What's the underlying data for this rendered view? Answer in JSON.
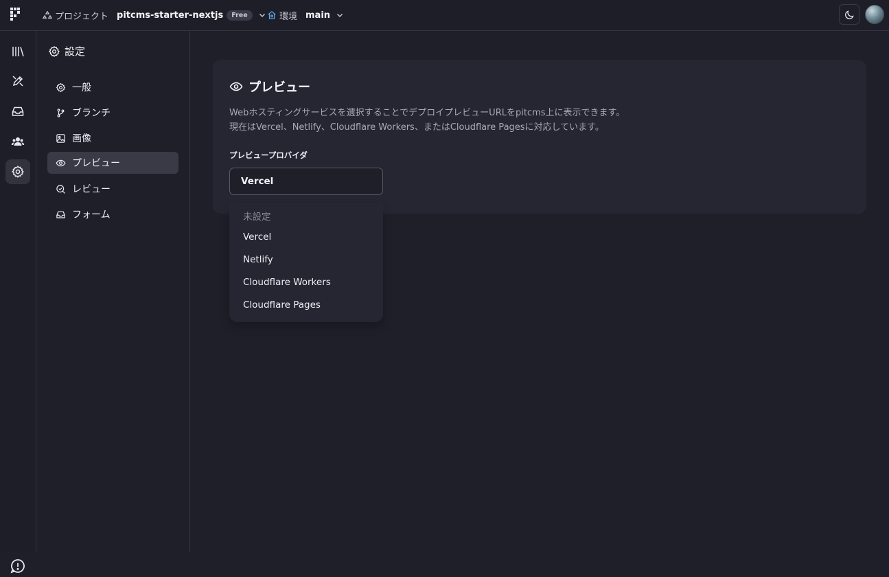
{
  "topbar": {
    "project_label": "プロジェクト",
    "project_name": "pitcms-starter-nextjs",
    "plan_badge": "Free",
    "env_label": "環境",
    "env_name": "main",
    "icons": [
      "logo-icon",
      "project-icon",
      "chevron-down-icon",
      "environment-icon",
      "moon-icon",
      "avatar"
    ]
  },
  "rail": {
    "items": [
      {
        "name": "library-icon"
      },
      {
        "name": "design-icon"
      },
      {
        "name": "inbox-icon"
      },
      {
        "name": "users-icon"
      },
      {
        "name": "settings-icon",
        "active": true
      },
      {
        "name": "help-icon"
      }
    ]
  },
  "sidebar": {
    "title": "設定",
    "items": [
      {
        "label": "一般",
        "icon": "gear-icon"
      },
      {
        "label": "ブランチ",
        "icon": "branch-icon"
      },
      {
        "label": "画像",
        "icon": "image-icon"
      },
      {
        "label": "プレビュー",
        "icon": "eye-icon",
        "active": true
      },
      {
        "label": "レビュー",
        "icon": "review-icon"
      },
      {
        "label": "フォーム",
        "icon": "inbox-icon"
      }
    ]
  },
  "main": {
    "title": "プレビュー",
    "description_line1": "Webホスティングサービスを選択することでデプロイプレビューURLをpitcms上に表示できます。",
    "description_line2": "現在はVercel、Netlify、Cloudflare Workers、またはCloudflare Pagesに対応しています。",
    "field_label": "プレビュープロバイダ",
    "selected_value": "Vercel",
    "options": [
      "未設定",
      "Vercel",
      "Netlify",
      "Cloudflare Workers",
      "Cloudflare Pages"
    ]
  },
  "colors": {
    "background": "#1f1f2a",
    "card": "#262633",
    "accent_env": "#5aa9e6"
  }
}
